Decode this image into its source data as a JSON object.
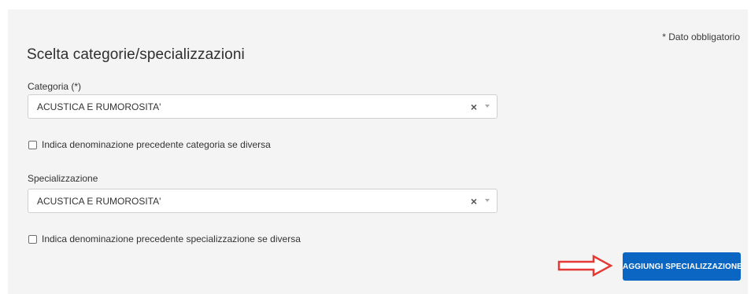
{
  "form": {
    "mandatory_note": "* Dato obbligatorio",
    "title": "Scelta categorie/specializzazioni",
    "category": {
      "label": "Categoria (*)",
      "selected": "ACUSTICA E RUMOROSITA'"
    },
    "category_checkbox_label": "Indica denominazione precedente categoria se diversa",
    "specialization": {
      "label": "Specializzazione",
      "selected": "ACUSTICA E RUMOROSITA'"
    },
    "specialization_checkbox_label": "Indica denominazione precedente specializzazione se diversa",
    "add_button_label": "AGGIUNGI SPECIALIZZAZIONE"
  },
  "icons": {
    "clear": "×",
    "annotation_arrow": "right-arrow-icon"
  },
  "colors": {
    "panel_background": "#f4f4f4",
    "button_primary": "#0a66c2",
    "annotation_arrow": "#e53935"
  }
}
